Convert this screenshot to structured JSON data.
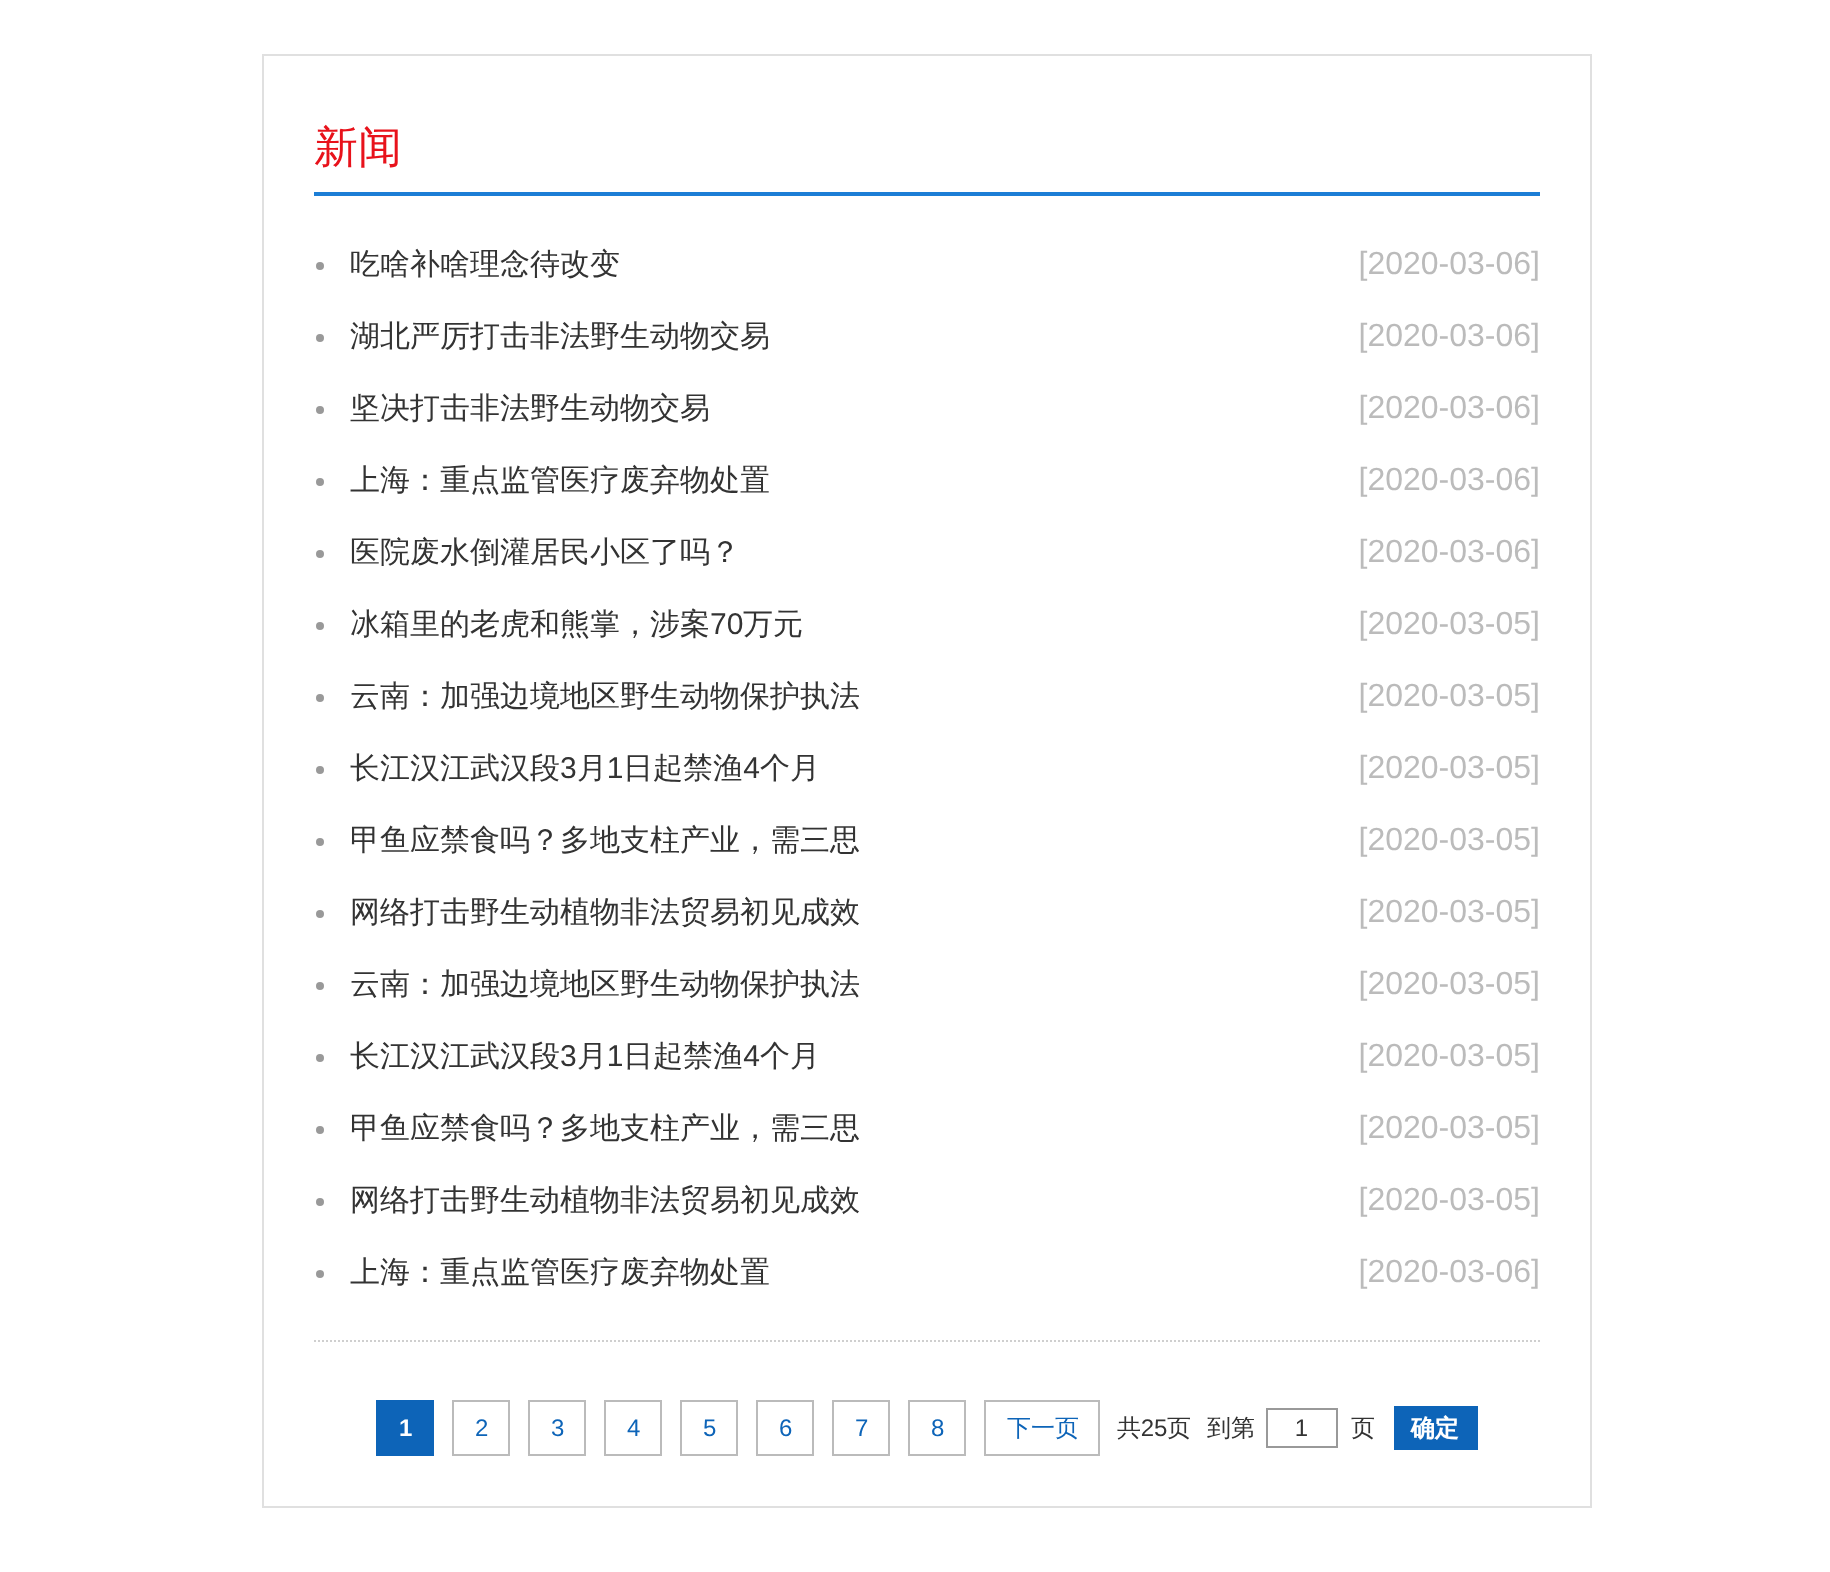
{
  "section": {
    "title": "新闻"
  },
  "news": [
    {
      "title": "吃啥补啥理念待改变",
      "date": "[2020-03-06]"
    },
    {
      "title": "湖北严厉打击非法野生动物交易",
      "date": "[2020-03-06]"
    },
    {
      "title": "坚决打击非法野生动物交易",
      "date": "[2020-03-06]"
    },
    {
      "title": "上海：重点监管医疗废弃物处置",
      "date": "[2020-03-06]"
    },
    {
      "title": "医院废水倒灌居民小区了吗？",
      "date": "[2020-03-06]"
    },
    {
      "title": "冰箱里的老虎和熊掌，涉案70万元",
      "date": "[2020-03-05]"
    },
    {
      "title": "云南：加强边境地区野生动物保护执法",
      "date": "[2020-03-05]"
    },
    {
      "title": "长江汉江武汉段3月1日起禁渔4个月",
      "date": "[2020-03-05]"
    },
    {
      "title": "甲鱼应禁食吗？多地支柱产业，需三思",
      "date": "[2020-03-05]"
    },
    {
      "title": "网络打击野生动植物非法贸易初见成效",
      "date": "[2020-03-05]"
    },
    {
      "title": "云南：加强边境地区野生动物保护执法",
      "date": "[2020-03-05]"
    },
    {
      "title": "长江汉江武汉段3月1日起禁渔4个月",
      "date": "[2020-03-05]"
    },
    {
      "title": "甲鱼应禁食吗？多地支柱产业，需三思",
      "date": "[2020-03-05]"
    },
    {
      "title": "网络打击野生动植物非法贸易初见成效",
      "date": "[2020-03-05]"
    },
    {
      "title": "上海：重点监管医疗废弃物处置",
      "date": "[2020-03-06]"
    }
  ],
  "pagination": {
    "pages": [
      {
        "label": "1",
        "selected": true
      },
      {
        "label": "2",
        "selected": false
      },
      {
        "label": "3",
        "selected": false
      },
      {
        "label": "4",
        "selected": false
      },
      {
        "label": "5",
        "selected": false
      },
      {
        "label": "6",
        "selected": false
      },
      {
        "label": "7",
        "selected": false
      },
      {
        "label": "8",
        "selected": false
      }
    ],
    "next": "下一页",
    "total": "共25页",
    "goto_label": "到第",
    "goto_value": "1",
    "goto_suffix": "页",
    "confirm": "确定"
  }
}
